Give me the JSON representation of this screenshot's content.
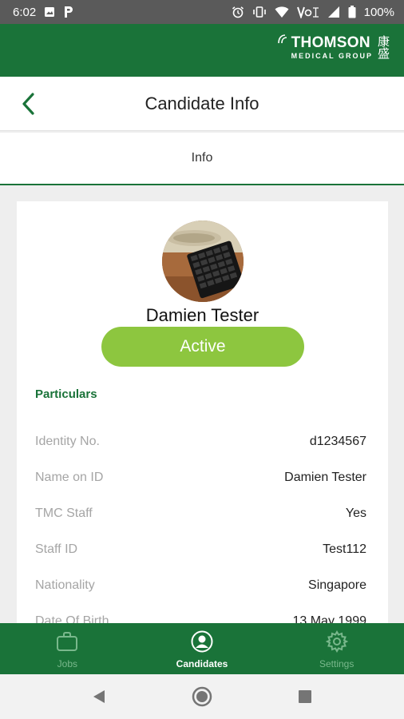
{
  "status_bar": {
    "time": "6:02",
    "battery": "100%"
  },
  "brand": {
    "name": "THOMSON",
    "sub": "MEDICAL GROUP",
    "glyph": "康盛"
  },
  "header": {
    "title": "Candidate Info"
  },
  "tabs": [
    {
      "label": "Info"
    }
  ],
  "candidate": {
    "name": "Damien Tester",
    "status": "Active"
  },
  "particulars": {
    "title": "Particulars",
    "rows": [
      {
        "label": "Identity No.",
        "value": "d1234567"
      },
      {
        "label": "Name on ID",
        "value": "Damien Tester"
      },
      {
        "label": "TMC Staff",
        "value": "Yes"
      },
      {
        "label": "Staff ID",
        "value": "Test112"
      },
      {
        "label": "Nationality",
        "value": "Singapore"
      },
      {
        "label": "Date Of Birth",
        "value": "13 May 1999"
      }
    ]
  },
  "bottom_nav": {
    "items": [
      {
        "label": "Jobs",
        "icon": "briefcase-icon"
      },
      {
        "label": "Candidates",
        "icon": "person-icon"
      },
      {
        "label": "Settings",
        "icon": "gear-icon"
      }
    ],
    "active_index": 1
  },
  "colors": {
    "brand_green": "#1a7339",
    "status_active": "#8dc63f"
  }
}
